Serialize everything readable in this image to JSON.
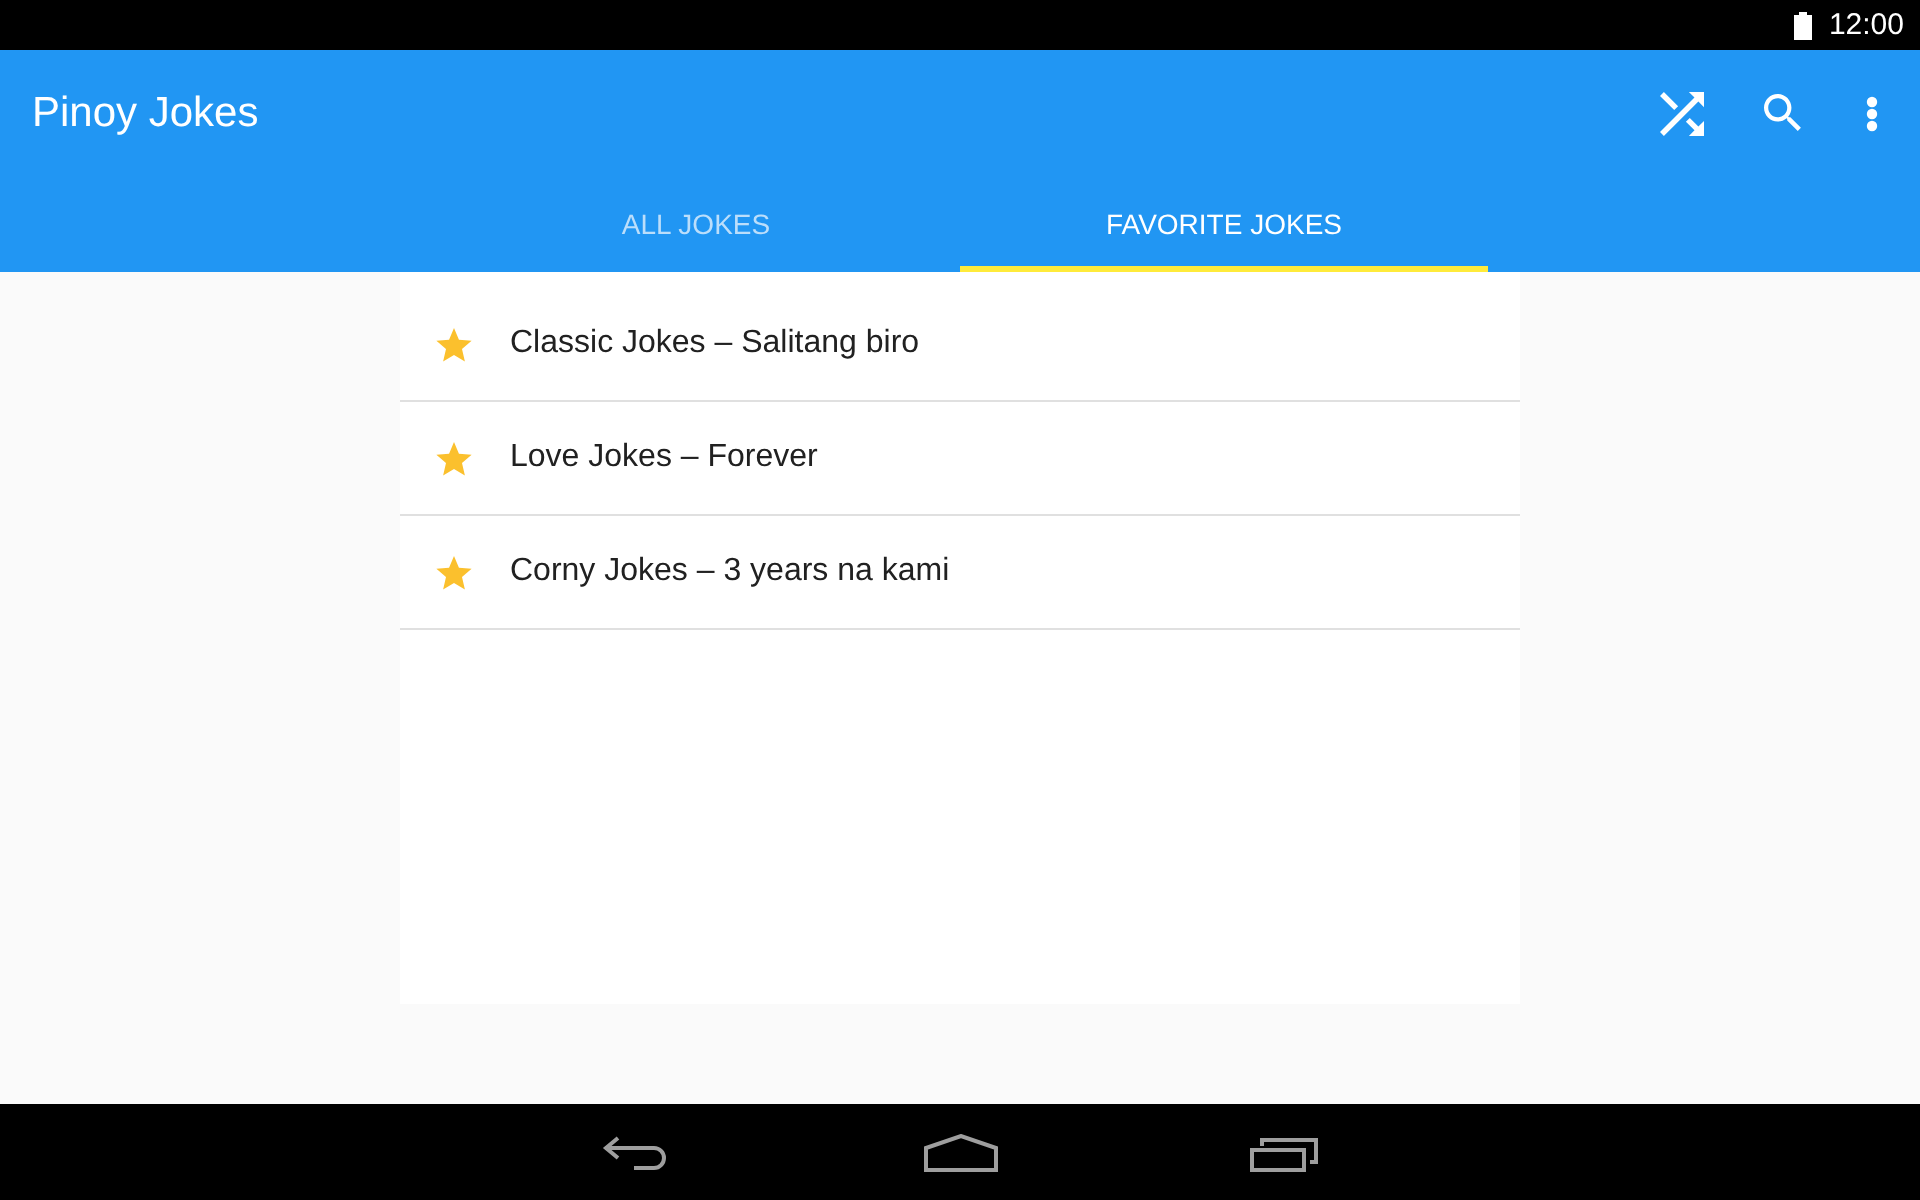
{
  "status_bar": {
    "time": "12:00"
  },
  "app_bar": {
    "title": "Pinoy Jokes"
  },
  "tabs": [
    {
      "label": "ALL JOKES",
      "selected": false
    },
    {
      "label": "FAVORITE JOKES",
      "selected": true
    }
  ],
  "jokes": [
    {
      "title": "Classic Jokes – Salitang biro",
      "favorite": true
    },
    {
      "title": "Love Jokes – Forever",
      "favorite": true
    },
    {
      "title": "Corny Jokes – 3 years na kami",
      "favorite": true
    }
  ]
}
